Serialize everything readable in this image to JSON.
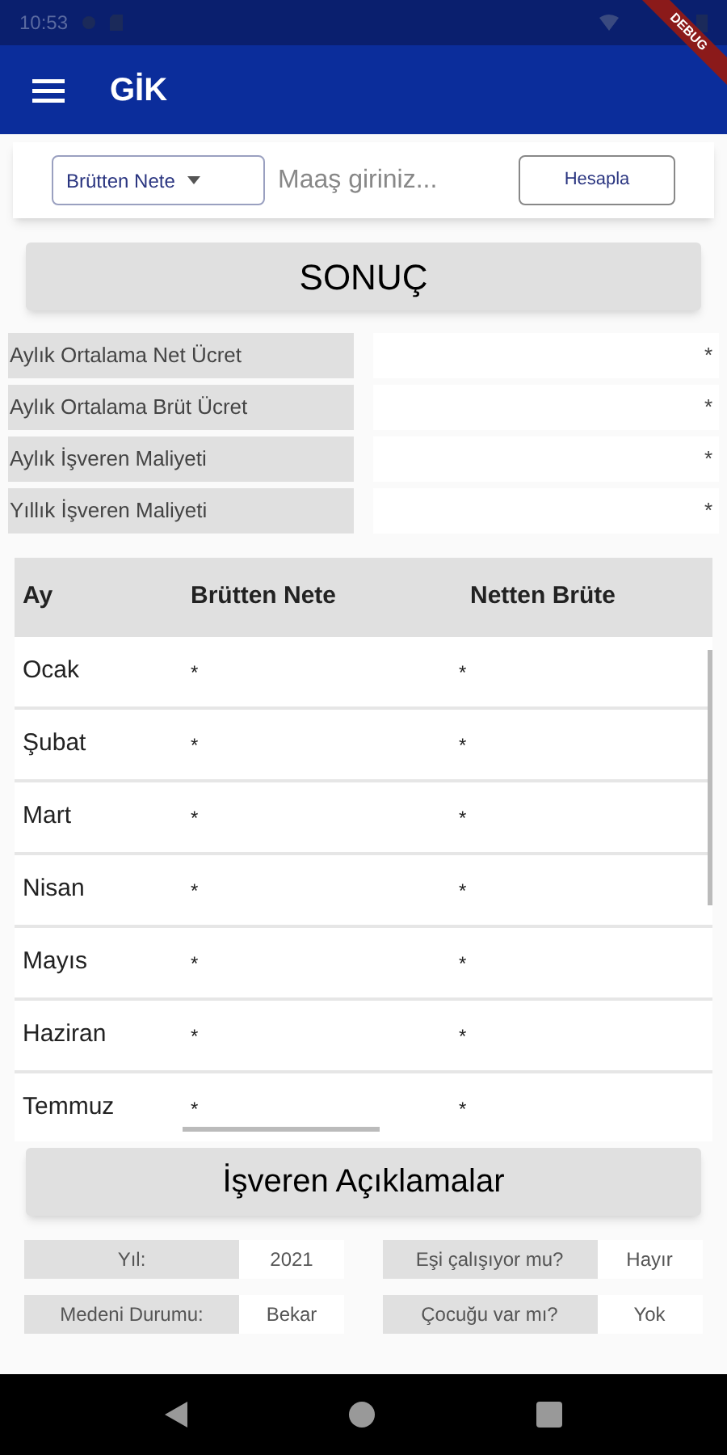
{
  "status_bar": {
    "time": "10:53"
  },
  "debug_banner": "DEBUG",
  "app_bar": {
    "title": "GİK"
  },
  "input_card": {
    "mode_dropdown": "Brütten Nete",
    "salary_field": {
      "placeholder": "Maaş giriniz..."
    },
    "calculate_button": "Hesapla"
  },
  "result_button": "SONUÇ",
  "summary": [
    {
      "label": "Aylık Ortalama Net Ücret",
      "value": "*"
    },
    {
      "label": "Aylık Ortalama Brüt Ücret",
      "value": "*"
    },
    {
      "label": "Aylık İşveren Maliyeti",
      "value": "*"
    },
    {
      "label": "Yıllık İşveren Maliyeti",
      "value": "*"
    }
  ],
  "table": {
    "columns": [
      "Ay",
      "Brütten Nete",
      "Netten Brüte"
    ],
    "rows": [
      [
        "Ocak",
        "*",
        "*"
      ],
      [
        "Şubat",
        "*",
        "*"
      ],
      [
        "Mart",
        "*",
        "*"
      ],
      [
        "Nisan",
        "*",
        "*"
      ],
      [
        "Mayıs",
        "*",
        "*"
      ],
      [
        "Haziran",
        "*",
        "*"
      ],
      [
        "Temmuz",
        "*",
        "*"
      ]
    ]
  },
  "employer_button": "İşveren Açıklamalar",
  "info": [
    {
      "label": "Yıl:",
      "value": "2021"
    },
    {
      "label": "Eşi çalışıyor mu?",
      "value": "Hayır"
    },
    {
      "label": "Medeni Durumu:",
      "value": "Bekar"
    },
    {
      "label": "Çocuğu var mı?",
      "value": "Yok"
    }
  ]
}
